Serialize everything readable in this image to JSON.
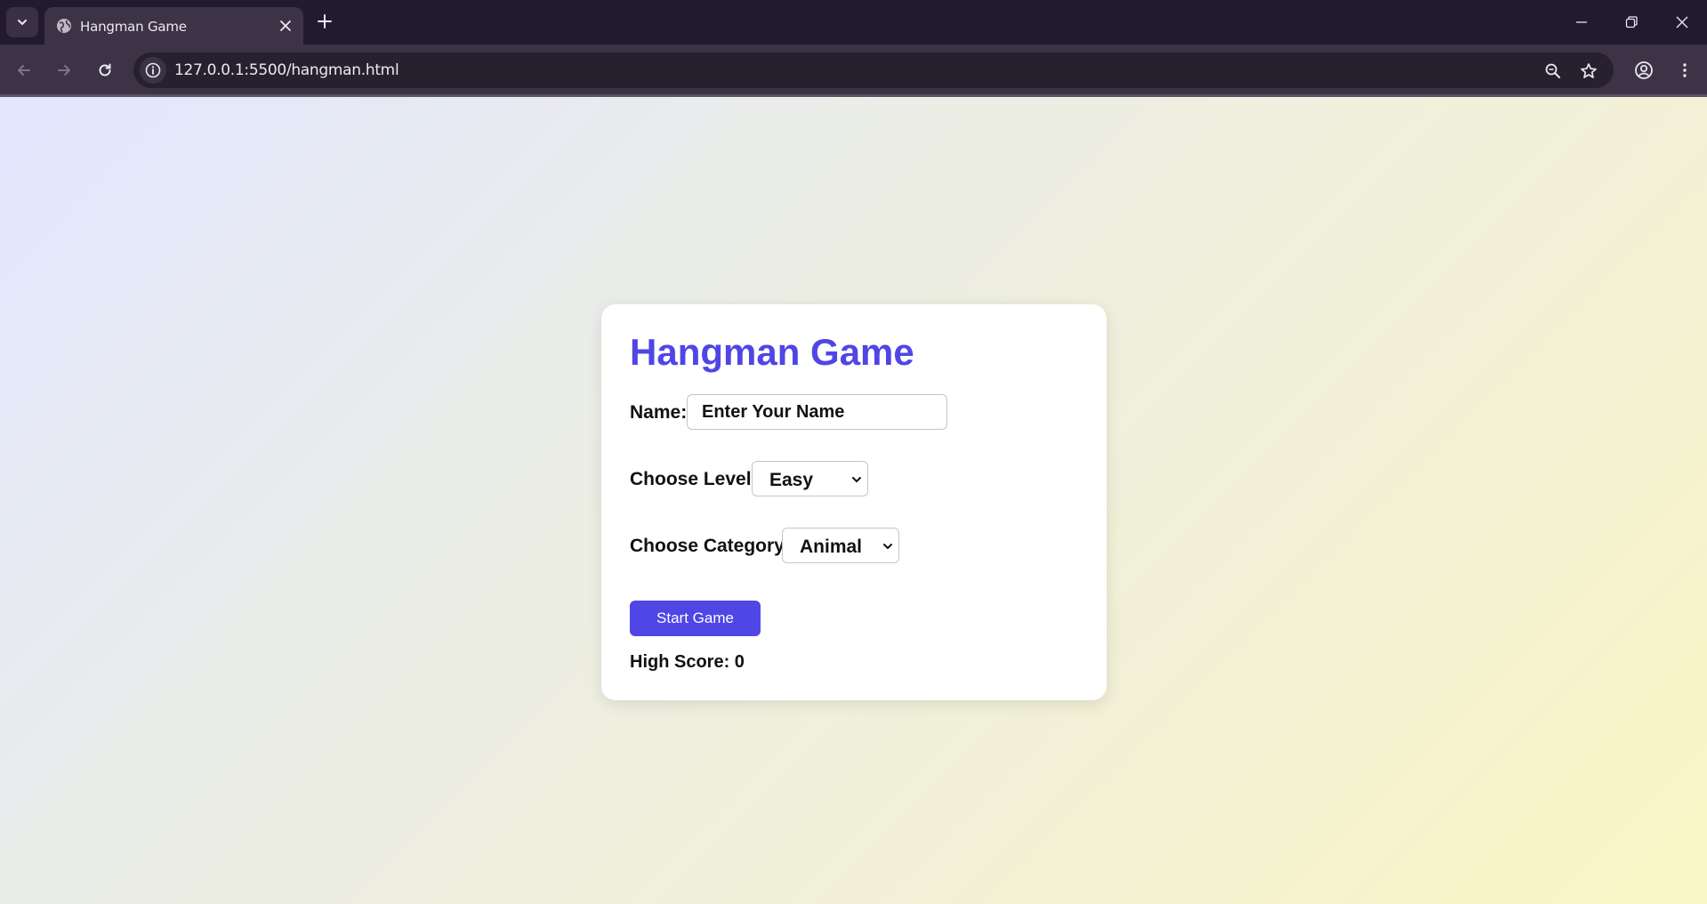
{
  "browser": {
    "tab_title": "Hangman Game",
    "url": "127.0.0.1:5500/hangman.html"
  },
  "game": {
    "title": "Hangman Game",
    "name_label": "Name:",
    "name_placeholder": "Enter Your Name",
    "level_label": "Choose Level:",
    "level_selected": "Easy",
    "category_label": "Choose Category:",
    "category_selected": "Animal",
    "start_button": "Start Game",
    "high_score": "High Score: 0"
  },
  "colors": {
    "accent": "#4f46e5",
    "tabstrip": "#221a2f",
    "toolbar": "#3c3347"
  }
}
